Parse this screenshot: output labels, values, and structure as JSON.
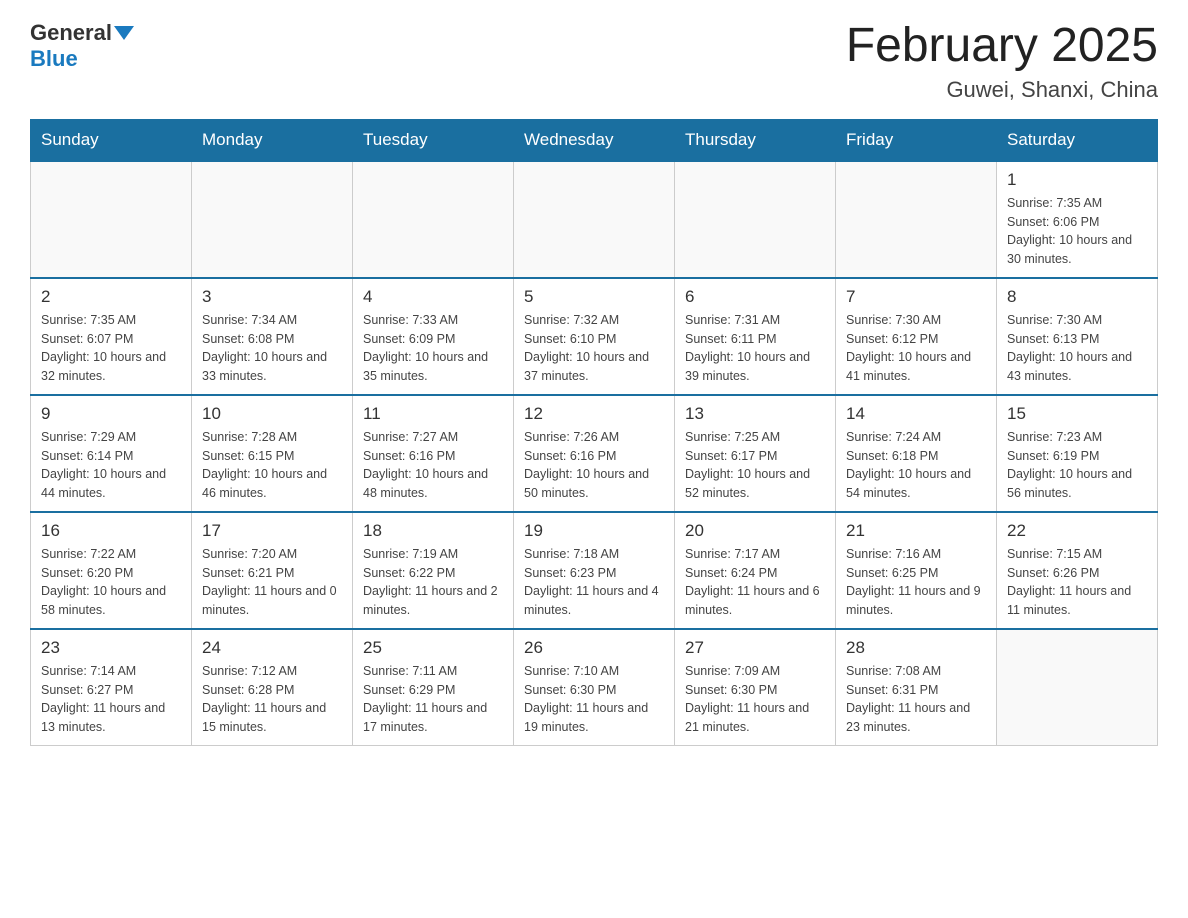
{
  "header": {
    "logo": {
      "text_general": "General",
      "text_blue": "Blue"
    },
    "title": "February 2025",
    "location": "Guwei, Shanxi, China"
  },
  "days_of_week": [
    "Sunday",
    "Monday",
    "Tuesday",
    "Wednesday",
    "Thursday",
    "Friday",
    "Saturday"
  ],
  "weeks": [
    [
      {
        "day": "",
        "sunrise": "",
        "sunset": "",
        "daylight": ""
      },
      {
        "day": "",
        "sunrise": "",
        "sunset": "",
        "daylight": ""
      },
      {
        "day": "",
        "sunrise": "",
        "sunset": "",
        "daylight": ""
      },
      {
        "day": "",
        "sunrise": "",
        "sunset": "",
        "daylight": ""
      },
      {
        "day": "",
        "sunrise": "",
        "sunset": "",
        "daylight": ""
      },
      {
        "day": "",
        "sunrise": "",
        "sunset": "",
        "daylight": ""
      },
      {
        "day": "1",
        "sunrise": "Sunrise: 7:35 AM",
        "sunset": "Sunset: 6:06 PM",
        "daylight": "Daylight: 10 hours and 30 minutes."
      }
    ],
    [
      {
        "day": "2",
        "sunrise": "Sunrise: 7:35 AM",
        "sunset": "Sunset: 6:07 PM",
        "daylight": "Daylight: 10 hours and 32 minutes."
      },
      {
        "day": "3",
        "sunrise": "Sunrise: 7:34 AM",
        "sunset": "Sunset: 6:08 PM",
        "daylight": "Daylight: 10 hours and 33 minutes."
      },
      {
        "day": "4",
        "sunrise": "Sunrise: 7:33 AM",
        "sunset": "Sunset: 6:09 PM",
        "daylight": "Daylight: 10 hours and 35 minutes."
      },
      {
        "day": "5",
        "sunrise": "Sunrise: 7:32 AM",
        "sunset": "Sunset: 6:10 PM",
        "daylight": "Daylight: 10 hours and 37 minutes."
      },
      {
        "day": "6",
        "sunrise": "Sunrise: 7:31 AM",
        "sunset": "Sunset: 6:11 PM",
        "daylight": "Daylight: 10 hours and 39 minutes."
      },
      {
        "day": "7",
        "sunrise": "Sunrise: 7:30 AM",
        "sunset": "Sunset: 6:12 PM",
        "daylight": "Daylight: 10 hours and 41 minutes."
      },
      {
        "day": "8",
        "sunrise": "Sunrise: 7:30 AM",
        "sunset": "Sunset: 6:13 PM",
        "daylight": "Daylight: 10 hours and 43 minutes."
      }
    ],
    [
      {
        "day": "9",
        "sunrise": "Sunrise: 7:29 AM",
        "sunset": "Sunset: 6:14 PM",
        "daylight": "Daylight: 10 hours and 44 minutes."
      },
      {
        "day": "10",
        "sunrise": "Sunrise: 7:28 AM",
        "sunset": "Sunset: 6:15 PM",
        "daylight": "Daylight: 10 hours and 46 minutes."
      },
      {
        "day": "11",
        "sunrise": "Sunrise: 7:27 AM",
        "sunset": "Sunset: 6:16 PM",
        "daylight": "Daylight: 10 hours and 48 minutes."
      },
      {
        "day": "12",
        "sunrise": "Sunrise: 7:26 AM",
        "sunset": "Sunset: 6:16 PM",
        "daylight": "Daylight: 10 hours and 50 minutes."
      },
      {
        "day": "13",
        "sunrise": "Sunrise: 7:25 AM",
        "sunset": "Sunset: 6:17 PM",
        "daylight": "Daylight: 10 hours and 52 minutes."
      },
      {
        "day": "14",
        "sunrise": "Sunrise: 7:24 AM",
        "sunset": "Sunset: 6:18 PM",
        "daylight": "Daylight: 10 hours and 54 minutes."
      },
      {
        "day": "15",
        "sunrise": "Sunrise: 7:23 AM",
        "sunset": "Sunset: 6:19 PM",
        "daylight": "Daylight: 10 hours and 56 minutes."
      }
    ],
    [
      {
        "day": "16",
        "sunrise": "Sunrise: 7:22 AM",
        "sunset": "Sunset: 6:20 PM",
        "daylight": "Daylight: 10 hours and 58 minutes."
      },
      {
        "day": "17",
        "sunrise": "Sunrise: 7:20 AM",
        "sunset": "Sunset: 6:21 PM",
        "daylight": "Daylight: 11 hours and 0 minutes."
      },
      {
        "day": "18",
        "sunrise": "Sunrise: 7:19 AM",
        "sunset": "Sunset: 6:22 PM",
        "daylight": "Daylight: 11 hours and 2 minutes."
      },
      {
        "day": "19",
        "sunrise": "Sunrise: 7:18 AM",
        "sunset": "Sunset: 6:23 PM",
        "daylight": "Daylight: 11 hours and 4 minutes."
      },
      {
        "day": "20",
        "sunrise": "Sunrise: 7:17 AM",
        "sunset": "Sunset: 6:24 PM",
        "daylight": "Daylight: 11 hours and 6 minutes."
      },
      {
        "day": "21",
        "sunrise": "Sunrise: 7:16 AM",
        "sunset": "Sunset: 6:25 PM",
        "daylight": "Daylight: 11 hours and 9 minutes."
      },
      {
        "day": "22",
        "sunrise": "Sunrise: 7:15 AM",
        "sunset": "Sunset: 6:26 PM",
        "daylight": "Daylight: 11 hours and 11 minutes."
      }
    ],
    [
      {
        "day": "23",
        "sunrise": "Sunrise: 7:14 AM",
        "sunset": "Sunset: 6:27 PM",
        "daylight": "Daylight: 11 hours and 13 minutes."
      },
      {
        "day": "24",
        "sunrise": "Sunrise: 7:12 AM",
        "sunset": "Sunset: 6:28 PM",
        "daylight": "Daylight: 11 hours and 15 minutes."
      },
      {
        "day": "25",
        "sunrise": "Sunrise: 7:11 AM",
        "sunset": "Sunset: 6:29 PM",
        "daylight": "Daylight: 11 hours and 17 minutes."
      },
      {
        "day": "26",
        "sunrise": "Sunrise: 7:10 AM",
        "sunset": "Sunset: 6:30 PM",
        "daylight": "Daylight: 11 hours and 19 minutes."
      },
      {
        "day": "27",
        "sunrise": "Sunrise: 7:09 AM",
        "sunset": "Sunset: 6:30 PM",
        "daylight": "Daylight: 11 hours and 21 minutes."
      },
      {
        "day": "28",
        "sunrise": "Sunrise: 7:08 AM",
        "sunset": "Sunset: 6:31 PM",
        "daylight": "Daylight: 11 hours and 23 minutes."
      },
      {
        "day": "",
        "sunrise": "",
        "sunset": "",
        "daylight": ""
      }
    ]
  ]
}
